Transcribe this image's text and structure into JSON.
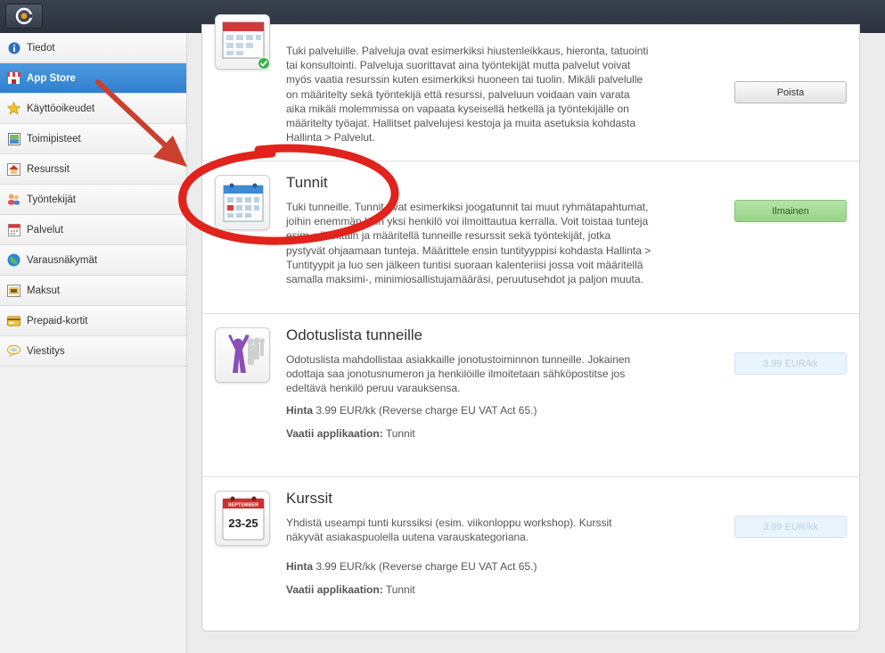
{
  "sidebar": {
    "items": [
      {
        "label": "Tiedot",
        "icon": "info-icon"
      },
      {
        "label": "App Store",
        "icon": "store-icon",
        "active": true
      },
      {
        "label": "Käyttöoikeudet",
        "icon": "star-icon"
      },
      {
        "label": "Toimipisteet",
        "icon": "map-icon"
      },
      {
        "label": "Resurssit",
        "icon": "house-icon"
      },
      {
        "label": "Työntekijät",
        "icon": "users-icon"
      },
      {
        "label": "Palvelut",
        "icon": "calendar-icon"
      },
      {
        "label": "Varausnäkymät",
        "icon": "globe-icon"
      },
      {
        "label": "Maksut",
        "icon": "payment-icon"
      },
      {
        "label": "Prepaid-kortit",
        "icon": "card-icon"
      },
      {
        "label": "Viestitys",
        "icon": "message-icon"
      }
    ]
  },
  "apps": [
    {
      "title": "",
      "description": "Tuki palveluille. Palveluja ovat esimerkiksi hiustenleikkaus, hieronta, tatuointi tai konsultointi. Palveluja suorittavat aina työntekijät mutta palvelut voivat myös vaatia resurssin kuten esimerkiksi huoneen tai tuolin. Mikäli palvelulle on määritelty sekä työntekijä että resurssi, palveluun voidaan vain varata aika mikäli molemmissa on vapaata kyseisellä hetkellä ja työntekijälle on määritelty työajat. Hallitset palvelujesi kestoja ja muita asetuksia kohdasta Hallinta > Palvelut.",
      "button": "Poista"
    },
    {
      "title": "Tunnit",
      "description": "Tuki tunneille. Tunnit ovat esimerkiksi joogatunnit tai muut ryhmätapahtumat, joihin enemmän kuin yksi henkilö voi ilmoittautua kerralla. Voit toistaa tunteja esim. viikoittain ja määritellä tunneille resurssit sekä työntekijät, jotka pystyvät ohjaamaan tunteja. Määrittele ensin tuntityyppisi kohdasta Hallinta > Tuntityypit ja luo sen jälkeen tuntisi suoraan kalenteriisi jossa voit määritellä samalla maksimi-, minimiosallistujamääräsi, peruutusehdot ja paljon muuta.",
      "button": "Ilmainen"
    },
    {
      "title": "Odotuslista tunneille",
      "description": "Odotuslista mahdollistaa asiakkaille jonotustoiminnon tunneille. Jokainen odottaja saa jonotusnumeron ja henkilöille ilmoitetaan sähköpostitse jos edeltävä henkilö peruu varauksensa.",
      "price_label": "Hinta",
      "price_text": "3.99 EUR/kk (Reverse charge EU VAT Act 65.)",
      "requires_label": "Vaatii applikaation:",
      "requires_text": "Tunnit",
      "button": "3.99 EUR/kk"
    },
    {
      "title": "Kurssit",
      "description": "Yhdistä useampi tunti kurssiksi (esim. viikonloppu workshop). Kurssit näkyvät asiakaspuolella uutena varauskategoriana.",
      "price_label": "Hinta",
      "price_text": "3.99 EUR/kk (Reverse charge EU VAT Act 65.)",
      "requires_label": "Vaatii applikaation:",
      "requires_text": "Tunnit",
      "button": "3.99 EUR/kk",
      "icon_month": "SEPTEMBER",
      "icon_dates": "23-25"
    }
  ],
  "colors": {
    "active_nav": "#3a8ad7",
    "free_button": "#a6db98",
    "annotation": "#e0231c",
    "arrow": "#c9412d"
  }
}
